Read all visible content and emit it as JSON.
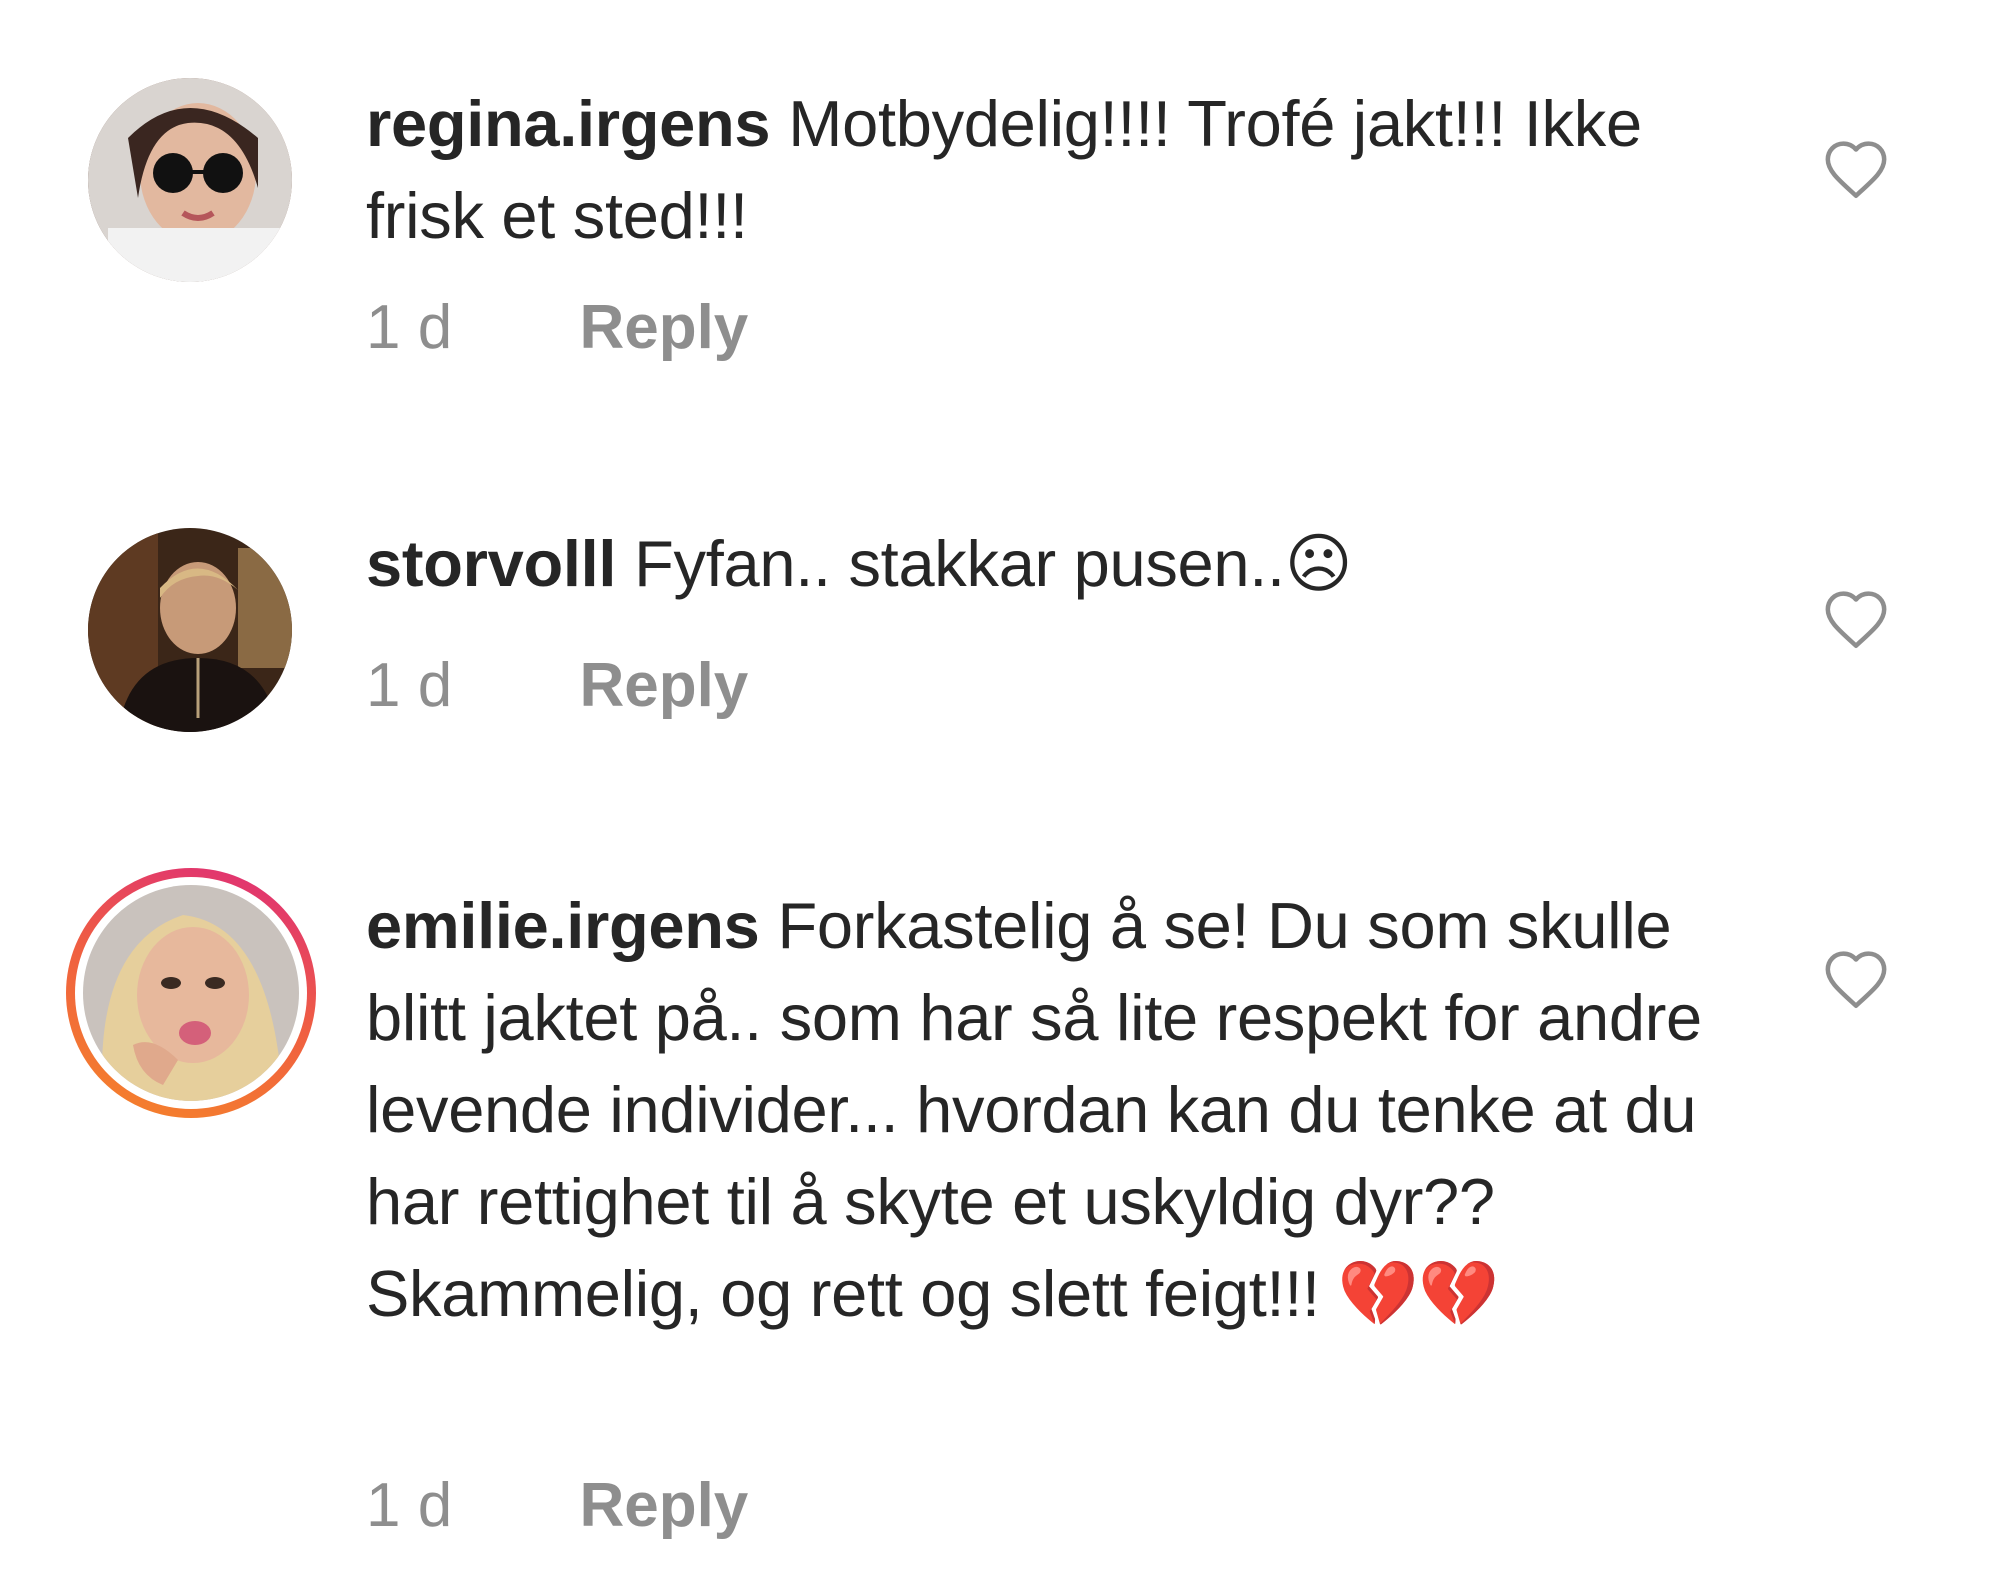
{
  "comments": [
    {
      "username": "regina.irgens",
      "text": "Motbydelig!!!! Trofé jakt!!! Ikke frisk et sted!!!",
      "time": "1 d",
      "reply_label": "Reply"
    },
    {
      "username": "storvolll",
      "text": "Fyfan.. stakkar pusen..☹",
      "time": "1 d",
      "reply_label": "Reply"
    },
    {
      "username": "emilie.irgens",
      "text": "Forkastelig å se! Du som skulle blitt jaktet på.. som har så lite respekt for andre levende individer... hvordan kan du tenke at du har rettighet til å skyte et uskyldig dyr?? Skammelig, og rett og slett feigt!!! 💔💔",
      "time": "1 d",
      "reply_label": "Reply",
      "has_story_ring": true
    }
  ],
  "colors": {
    "text": "#262626",
    "secondary": "#8e8e8e",
    "heart_outline": "#8e8e8e",
    "story_ring_start": "#f58529",
    "story_ring_end": "#dd2a7b"
  },
  "icons": {
    "like": "heart-outline-icon"
  }
}
